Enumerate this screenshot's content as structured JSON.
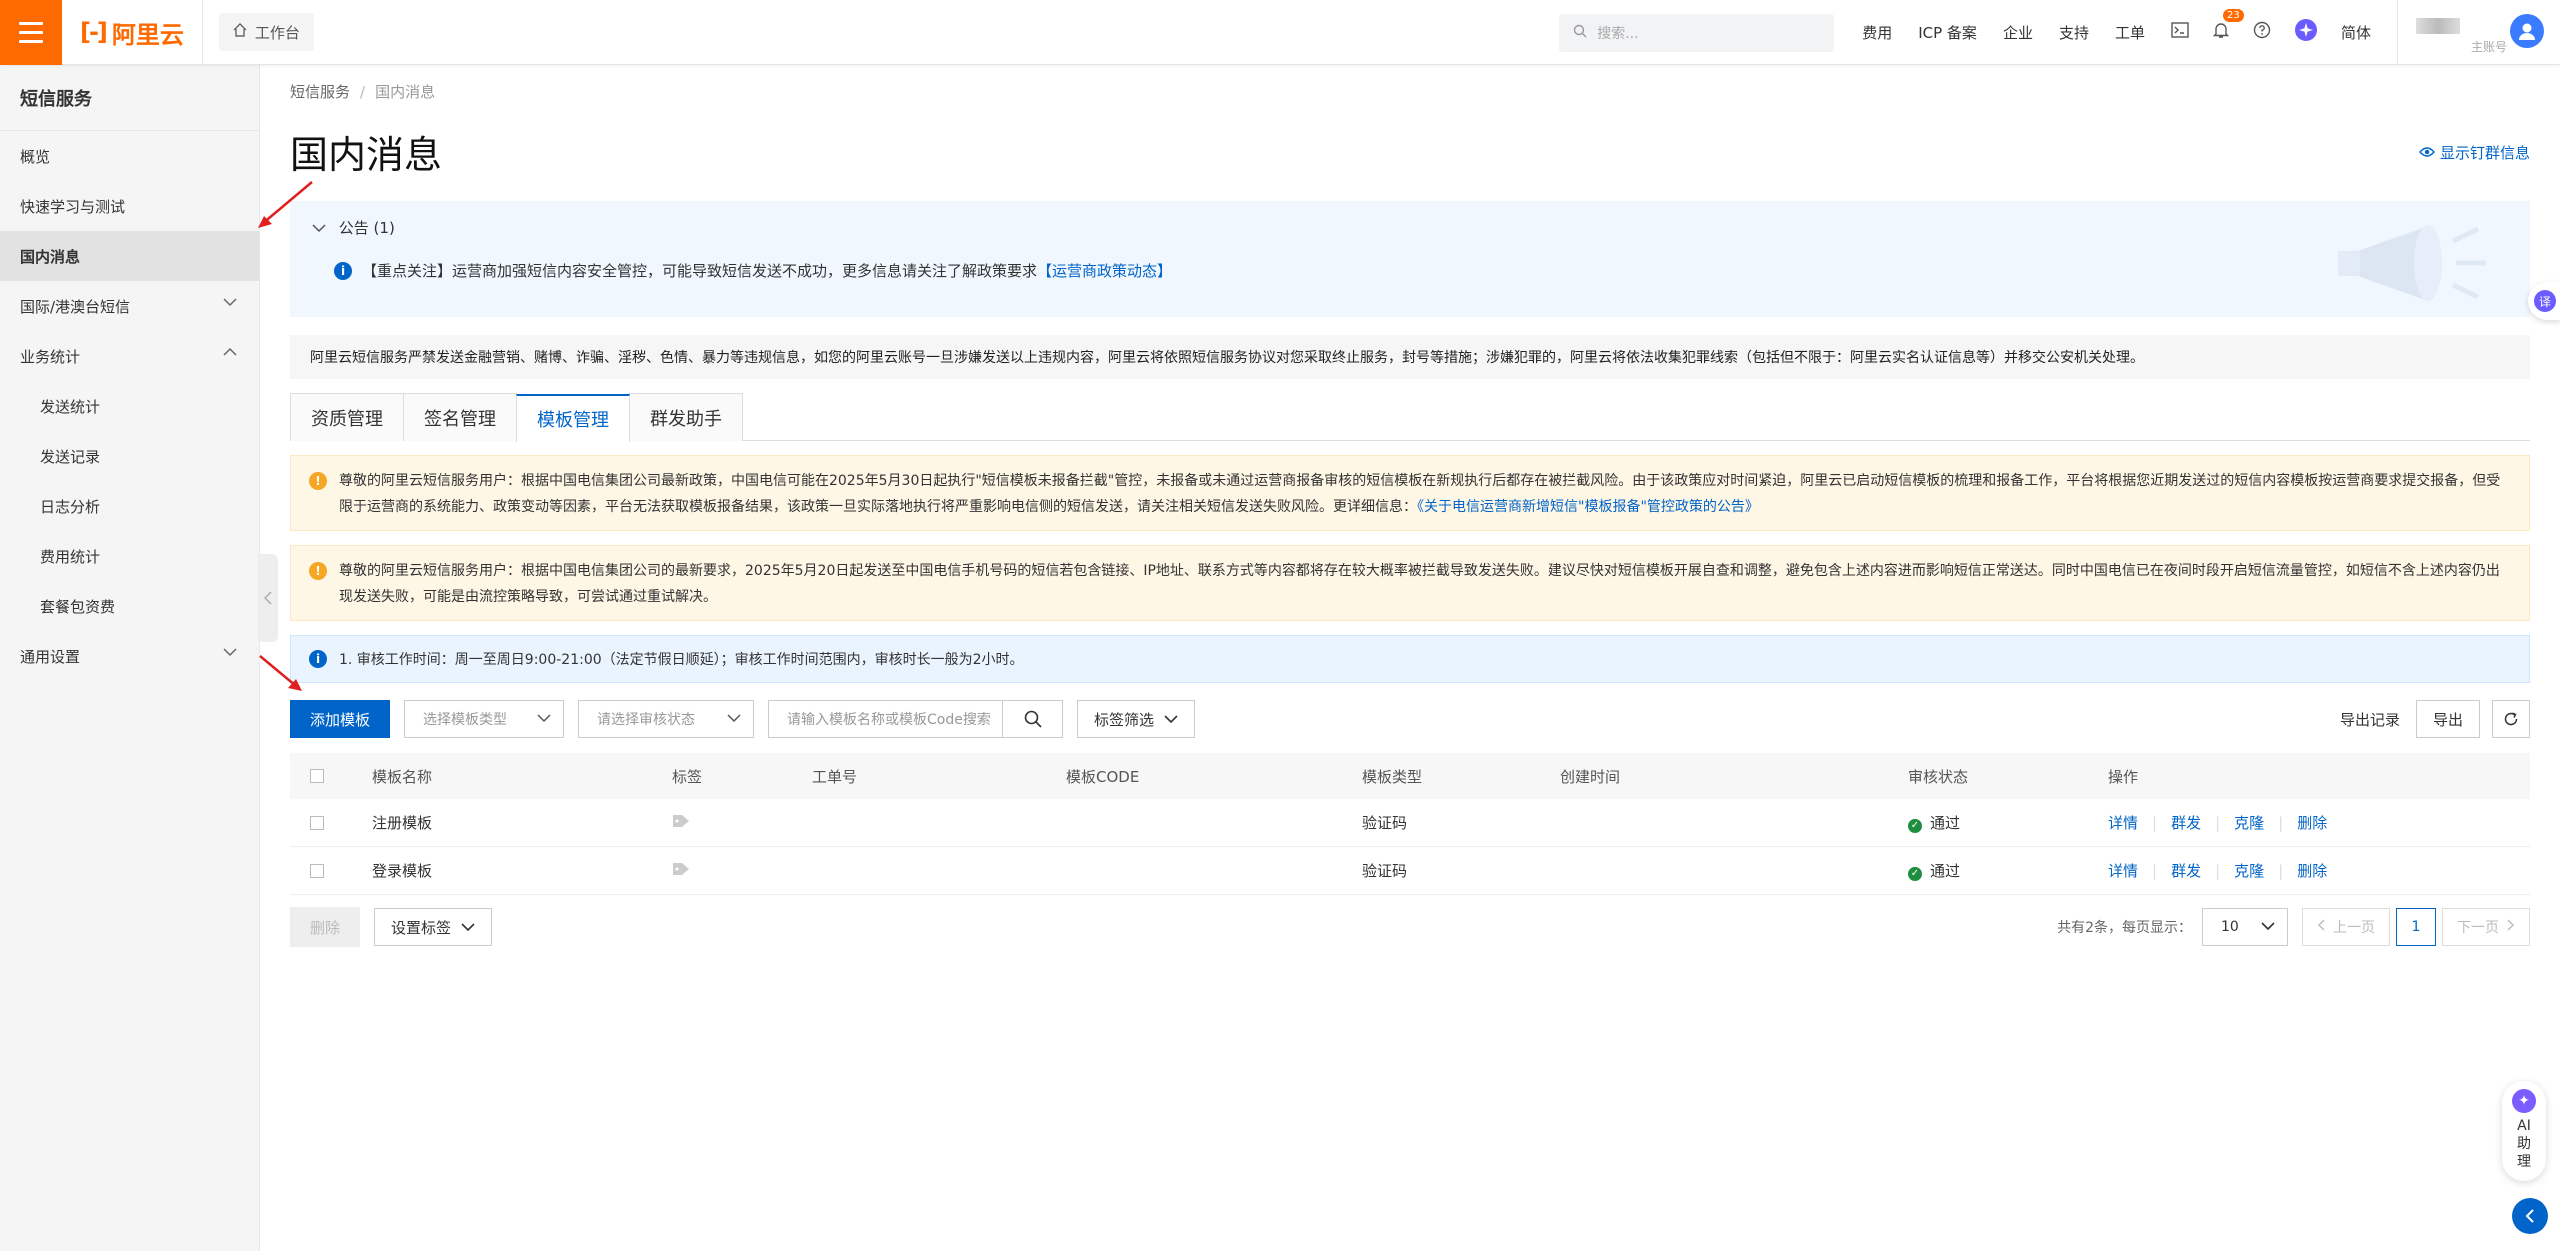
{
  "topbar": {
    "logo_text": "阿里云",
    "workbench": "工作台",
    "search_placeholder": "搜索...",
    "links": [
      "费用",
      "ICP 备案",
      "企业",
      "支持",
      "工单"
    ],
    "notification_count": "23",
    "language": "简体",
    "account_label": "主账号"
  },
  "sidebar": {
    "title": "短信服务",
    "items": [
      {
        "label": "概览"
      },
      {
        "label": "快速学习与测试"
      },
      {
        "label": "国内消息"
      },
      {
        "label": "国际/港澳台短信"
      },
      {
        "label": "业务统计"
      },
      {
        "label": "发送统计"
      },
      {
        "label": "发送记录"
      },
      {
        "label": "日志分析"
      },
      {
        "label": "费用统计"
      },
      {
        "label": "套餐包资费"
      },
      {
        "label": "通用设置"
      }
    ]
  },
  "breadcrumb": {
    "root": "短信服务",
    "current": "国内消息"
  },
  "page": {
    "title": "国内消息",
    "pin_link": "显示钉群信息"
  },
  "notice": {
    "header": "公告 (1)",
    "text": "【重点关注】运营商加强短信内容安全管控，可能导致短信发送不成功，更多信息请关注了解政策要求",
    "link": "【运营商政策动态】"
  },
  "warning_bar": "阿里云短信服务严禁发送金融营销、赌博、诈骗、淫秽、色情、暴力等违规信息，如您的阿里云账号一旦涉嫌发送以上违规内容，阿里云将依照短信服务协议对您采取终止服务，封号等措施；涉嫌犯罪的，阿里云将依法收集犯罪线索（包括但不限于：阿里云实名认证信息等）并移交公安机关处理。",
  "tabs": [
    {
      "label": "资质管理"
    },
    {
      "label": "签名管理"
    },
    {
      "label": "模板管理"
    },
    {
      "label": "群发助手"
    }
  ],
  "alert1": {
    "text": "尊敬的阿里云短信服务用户：根据中国电信集团公司最新政策，中国电信可能在2025年5月30日起执行\"短信模板未报备拦截\"管控，未报备或未通过运营商报备审核的短信模板在新规执行后都存在被拦截风险。由于该政策应对时间紧迫，阿里云已启动短信模板的梳理和报备工作，平台将根据您近期发送过的短信内容模板按运营商要求提交报备，但受限于运营商的系统能力、政策变动等因素，平台无法获取模板报备结果，该政策一旦实际落地执行将严重影响电信侧的短信发送，请关注相关短信发送失败风险。更详细信息：",
    "link": "《关于电信运营商新增短信\"模板报备\"管控政策的公告》"
  },
  "alert2": {
    "text": "尊敬的阿里云短信服务用户：根据中国电信集团公司的最新要求，2025年5月20日起发送至中国电信手机号码的短信若包含链接、IP地址、联系方式等内容都将存在较大概率被拦截导致发送失败。建议尽快对短信模板开展自查和调整，避免包含上述内容进而影响短信正常送达。同时中国电信已在夜间时段开启短信流量管控，如短信不含上述内容仍出现发送失败，可能是由流控策略导致，可尝试通过重试解决。"
  },
  "info_box": "1. 审核工作时间：周一至周日9:00-21:00（法定节假日顺延）；审核工作时间范围内，审核时长一般为2小时。",
  "toolbar": {
    "add_button": "添加模板",
    "type_placeholder": "选择模板类型",
    "status_placeholder": "请选择审核状态",
    "search_placeholder": "请输入模板名称或模板Code搜索",
    "tag_filter": "标签筛选",
    "export_record": "导出记录",
    "export": "导出"
  },
  "table": {
    "headers": [
      "模板名称",
      "标签",
      "工单号",
      "模板CODE",
      "模板类型",
      "创建时间",
      "审核状态",
      "操作"
    ],
    "rows": [
      {
        "name": "注册模板",
        "type": "验证码",
        "status": "通过"
      },
      {
        "name": "登录模板",
        "type": "验证码",
        "status": "通过"
      }
    ],
    "ops": [
      "详情",
      "群发",
      "克隆",
      "删除"
    ]
  },
  "footer": {
    "delete": "删除",
    "set_tag": "设置标签",
    "total_text": "共有2条，每页显示：",
    "page_size": "10",
    "prev": "上一页",
    "page": "1",
    "next": "下一页"
  },
  "floating": {
    "translate": "译",
    "ai_helper": "AI助理"
  },
  "colors": {
    "brand": "#ff6a00",
    "primary": "#0064c8",
    "success": "#1e8e3e",
    "warning": "#f5a623"
  }
}
